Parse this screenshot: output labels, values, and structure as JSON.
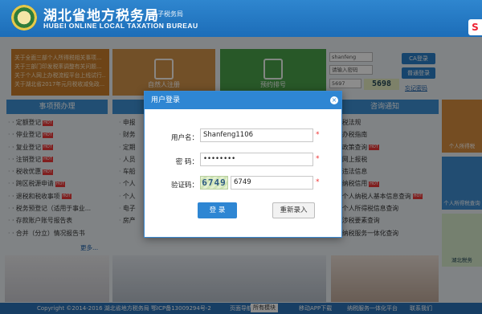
{
  "header": {
    "title": "湖北省地方税务局",
    "subtitle": "电子税务局",
    "title_en": "HUBEI ONLINE LOCAL TAXATION BUREAU",
    "badge": "S"
  },
  "notices": [
    "关于全面三部个人所得税相关事项...",
    "关于三部门印发税率调整有关问题...",
    "关于个人网上办税流程平台上线试行...",
    "关于湖北省2017年元月税收减免政..."
  ],
  "tiles": {
    "orange_label": "自然人注册",
    "green_label": "预约排号"
  },
  "login_panel": {
    "username": "shanfeng",
    "password_placeholder": "请输入密码",
    "captcha_input": "5697",
    "captcha_code": "5698",
    "ca_button": "CA登录",
    "normal_button": "普通登录",
    "forgot_link": "忘记密码"
  },
  "sections": {
    "left_title": "事项预办理",
    "right_title": "咨询通知"
  },
  "left_list": [
    {
      "text": "· 定额登记",
      "hot": "HOT"
    },
    {
      "text": "· 停业登记",
      "hot": "HOT"
    },
    {
      "text": "· 复业登记",
      "hot": "HOT"
    },
    {
      "text": "· 注销登记",
      "hot": "HOT"
    },
    {
      "text": "· 税收优惠",
      "hot": "HOT"
    },
    {
      "text": "· 跨区税源申请",
      "hot": "HOT"
    },
    {
      "text": "· 退税和税收事项",
      "hot": "HOT"
    },
    {
      "text": "· 税务预登记（适用于事业...",
      "hot": ""
    },
    {
      "text": "· 存款账户账号报告表",
      "hot": ""
    },
    {
      "text": "· 合并（分立）情况报告书",
      "hot": ""
    }
  ],
  "mid_list": [
    "申报",
    "财务",
    "定期",
    "人员",
    "车船",
    "个人",
    "个人",
    "电子",
    "房产"
  ],
  "right_list": [
    {
      "text": "· 税法规",
      "hot": ""
    },
    {
      "text": "· 办税指南",
      "hot": ""
    },
    {
      "text": "· 政策查询",
      "hot": "HOT"
    },
    {
      "text": "· 网上报税",
      "hot": ""
    },
    {
      "text": "· 违法信息",
      "hot": ""
    },
    {
      "text": "· 纳税信用",
      "hot": "HOT"
    },
    {
      "text": "· 个人纳税人基本信息查询",
      "hot": "HOT"
    },
    {
      "text": "· 个人所得税信息查询",
      "hot": ""
    },
    {
      "text": "· 涉税要素查询",
      "hot": ""
    },
    {
      "text": "· 纳税服务一体化查询",
      "hot": ""
    }
  ],
  "more_link": "更多...",
  "side_cards": [
    {
      "label": "个人所得税",
      "color": "#d68d3e"
    },
    {
      "label": "个人所得税查询",
      "color": "#3f8dcf"
    },
    {
      "label": "湖北税务",
      "color": "#d5eacb"
    }
  ],
  "footer": {
    "copyright": "Copyright ©2014-2016 湖北省地方税务局 鄂ICP备13009294号-2",
    "nav_label": "页面导航",
    "nav_value": "所有模块",
    "app_download": "移动APP下载",
    "service_link": "纳税服务一体化平台",
    "contact": "联系我们"
  },
  "dialog": {
    "title": "用户登录",
    "close_glyph": "×",
    "username_label": "用户名：",
    "username_value": "Shanfeng1106",
    "password_label": "密  码：",
    "password_value": "••••••••",
    "captcha_label": "验证码：",
    "captcha_image_text": "6749",
    "captcha_value": "6749",
    "required_mark": "*",
    "login_button": "登 录",
    "reset_button": "重新录入"
  }
}
